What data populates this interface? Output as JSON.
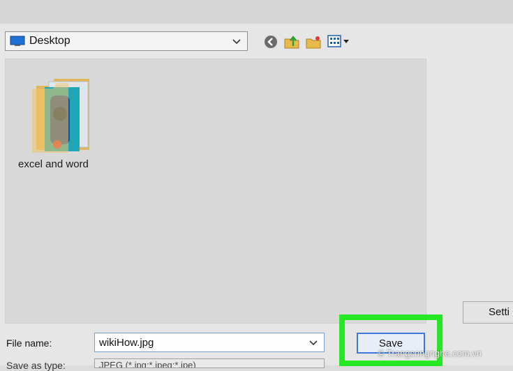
{
  "location": {
    "value": "Desktop",
    "icon": "desktop-icon"
  },
  "toolbar": {
    "icons": [
      "back-icon",
      "up-folder-icon",
      "new-folder-icon",
      "view-menu-icon"
    ]
  },
  "files": [
    {
      "name": "excel and word",
      "icon": "folder-icon"
    }
  ],
  "settings_button": {
    "label": "Setti"
  },
  "filename": {
    "label": "File name:",
    "value": "wikiHow.jpg"
  },
  "savetype": {
    "label": "Save as type:",
    "value": "JPEG (*.jpg;*.jpeg;*.jpe)"
  },
  "save_button": {
    "label": "Save"
  },
  "watermark": {
    "text": "© Trangcongnghe.com.vn"
  },
  "colors": {
    "highlight": "#27e827",
    "focus_border": "#3a77d8"
  }
}
